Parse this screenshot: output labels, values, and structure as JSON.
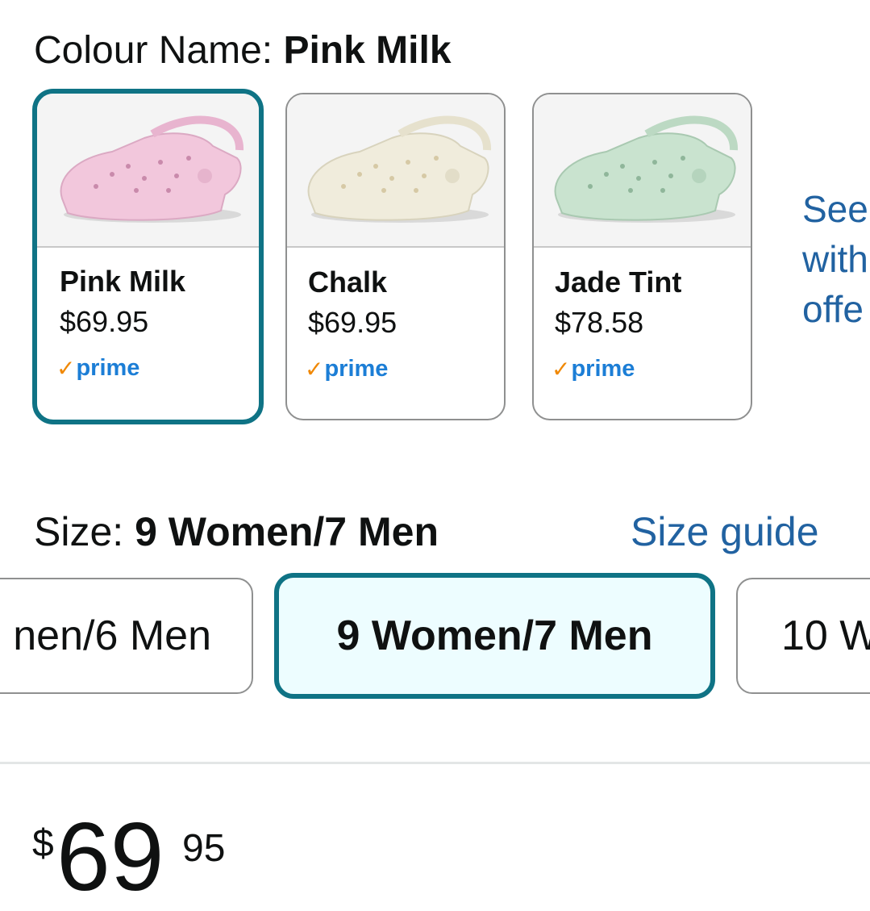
{
  "colour": {
    "label": "Colour Name:",
    "selected": "Pink Milk"
  },
  "swatches": [
    {
      "name": "Pink Milk",
      "price": "$69.95",
      "badge": "prime",
      "color": "#f2c7dc",
      "selected": true
    },
    {
      "name": "Chalk",
      "price": "$69.95",
      "badge": "prime",
      "color": "#f0ecdc",
      "selected": false
    },
    {
      "name": "Jade Tint",
      "price": "$78.58",
      "badge": "prime",
      "color": "#c9e3cf",
      "selected": false
    }
  ],
  "see_more": {
    "text": "See\nwith\noffe"
  },
  "size": {
    "label": "Size:",
    "selected": "9 Women/7 Men",
    "guide_label": "Size guide",
    "options": [
      "nen/6 Men",
      "9 Women/7 Men",
      "10 W"
    ]
  },
  "price": {
    "symbol": "$",
    "whole": "69",
    "fraction": "95"
  },
  "colors": {
    "selected_border": "#0f7385",
    "link": "#2162a1",
    "prime_blue": "#1c7ed6",
    "prime_check": "#f08804",
    "selected_size_bg": "#edfdff"
  }
}
